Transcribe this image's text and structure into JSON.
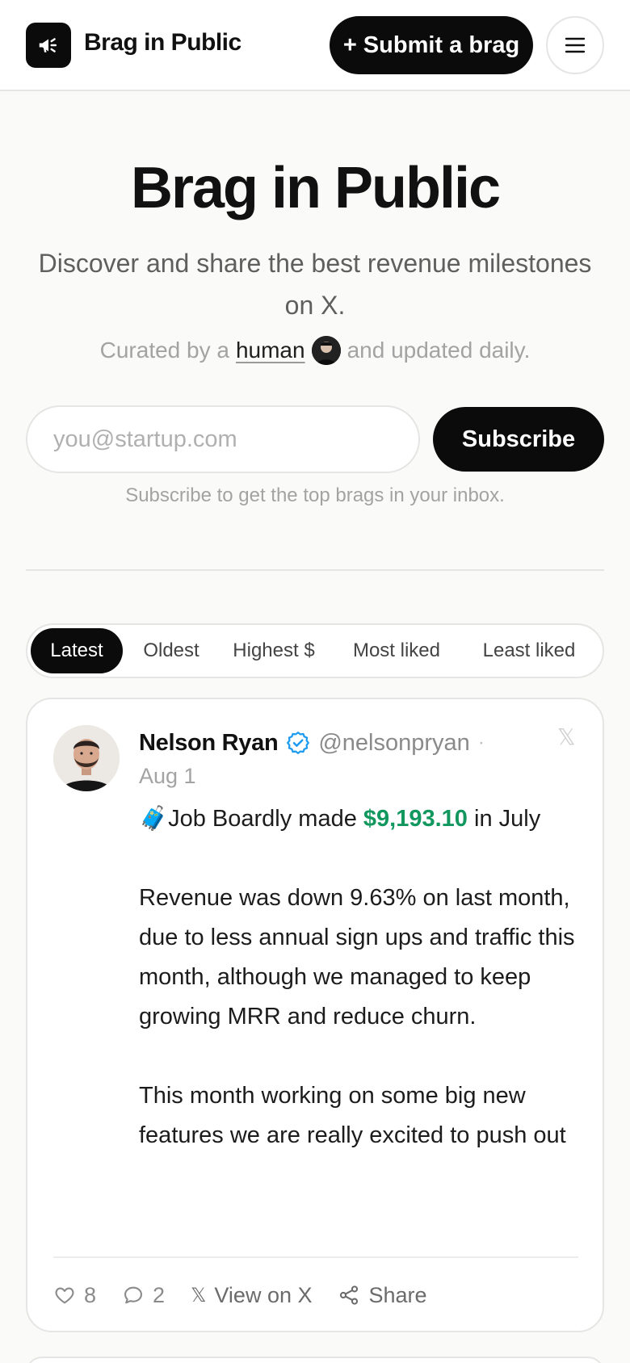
{
  "header": {
    "brand": "Brag in Public",
    "submit_label": "+ Submit a brag",
    "logo_icon": "megaphone-icon",
    "menu_icon": "hamburger-menu-icon"
  },
  "hero": {
    "title": "Brag in Public",
    "subtitle": "Discover and share the best revenue milestones on X.",
    "curated_prefix": "Curated by a",
    "curated_link": "human",
    "curated_suffix": "and updated daily."
  },
  "subscribe": {
    "placeholder": "you@startup.com",
    "button_label": "Subscribe",
    "note": "Subscribe to get the top brags in your inbox."
  },
  "tabs": [
    {
      "label": "Latest",
      "active": true
    },
    {
      "label": "Oldest",
      "active": false
    },
    {
      "label": "Highest $",
      "active": false
    },
    {
      "label": "Most liked",
      "active": false
    },
    {
      "label": "Least liked",
      "active": false
    }
  ],
  "post": {
    "author_name": "Nelson Ryan",
    "handle": "@nelsonpryan",
    "separator": "·",
    "date": "Aug 1",
    "verified_icon": "verified-badge-icon",
    "x_icon": "x-logo-icon",
    "line1_emoji": "🧳",
    "line1_prefix": "Job Boardly made",
    "line1_amount": "$9,193.10",
    "line1_suffix": "in July",
    "paragraph2": "Revenue was down 9.63% on last month, due to less annual sign ups and traffic this month, although we managed to keep growing MRR and reduce churn.",
    "paragraph3": "This month working on some big new features we are really excited to push out",
    "likes": "8",
    "comments": "2",
    "view_label": "View on X",
    "share_label": "Share"
  },
  "colors": {
    "accent_dark": "#0b0b0b",
    "amount_green": "#12985f",
    "verified_blue": "#1d9bf0",
    "background": "#fafaf9"
  }
}
